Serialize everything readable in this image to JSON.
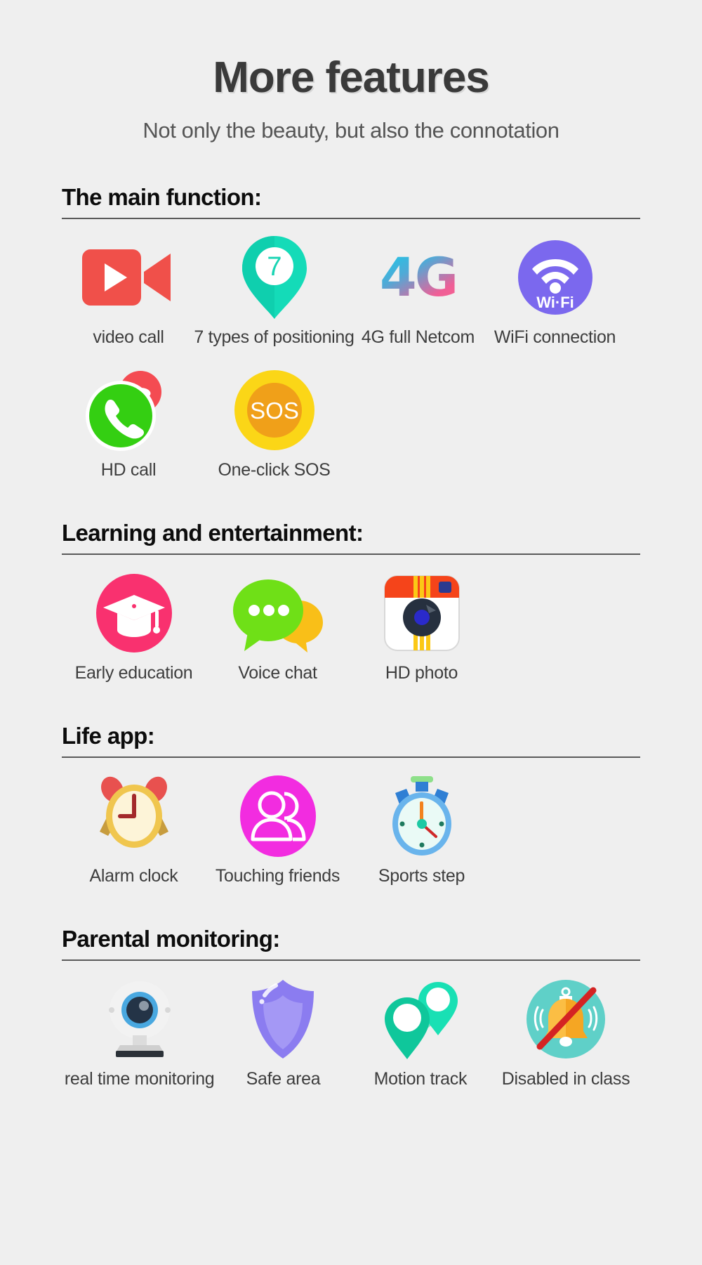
{
  "header": {
    "title": "More features",
    "subtitle": "Not only the beauty, but also the connotation"
  },
  "sections": [
    {
      "id": "main-function",
      "heading": "The main function:",
      "rows": [
        [
          {
            "label": "video call",
            "icon": "video-camera-icon",
            "color": "#f0504a"
          },
          {
            "label": "7 types of positioning",
            "icon": "map-pin-seven-icon",
            "color": "#1fd9b4",
            "badge_text": "7"
          },
          {
            "label": "4G full Netcom",
            "icon": "four-g-icon",
            "text": "4G",
            "color": "#ef5f97"
          },
          {
            "label": "WiFi connection",
            "icon": "wifi-icon",
            "color": "#7b68ee",
            "text": "Wi·Fi"
          }
        ],
        [
          {
            "label": "HD call",
            "icon": "phone-call-icon",
            "color": "#34cf12"
          },
          {
            "label": "One-click SOS",
            "icon": "sos-icon",
            "color": "#f7b419",
            "text": "SOS"
          }
        ]
      ]
    },
    {
      "id": "learning-entertainment",
      "heading": "Learning and entertainment:",
      "rows": [
        [
          {
            "label": "Early education",
            "icon": "graduation-cap-icon",
            "color": "#f9316f"
          },
          {
            "label": "Voice chat",
            "icon": "chat-bubbles-icon",
            "color": "#6fe017"
          },
          {
            "label": "HD photo",
            "icon": "retro-camera-icon",
            "color": "#f5441a"
          }
        ]
      ]
    },
    {
      "id": "life-app",
      "heading": "Life app:",
      "rows": [
        [
          {
            "label": "Alarm clock",
            "icon": "alarm-clock-icon",
            "color": "#f0c64e"
          },
          {
            "label": "Touching friends",
            "icon": "two-people-icon",
            "color": "#f22ce0"
          },
          {
            "label": "Sports step",
            "icon": "stopwatch-icon",
            "color": "#5aa8e8"
          }
        ]
      ]
    },
    {
      "id": "parental-monitoring",
      "heading": "Parental monitoring:",
      "rows": [
        [
          {
            "label": "real time monitoring",
            "icon": "webcam-icon",
            "color": "#49a8e0"
          },
          {
            "label": "Safe area",
            "icon": "shield-icon",
            "color": "#8b7cf0"
          },
          {
            "label": "Motion track",
            "icon": "motion-track-pins-icon",
            "color": "#13cfa0"
          },
          {
            "label": "Disabled in class",
            "icon": "bell-muted-icon",
            "color": "#5fd0c8"
          }
        ]
      ]
    }
  ],
  "theme": {
    "background": "#efefef",
    "heading_color": "#0c0c0c",
    "label_color": "#3d3d3d",
    "rule_color": "#5a5a5a"
  }
}
